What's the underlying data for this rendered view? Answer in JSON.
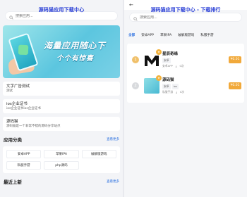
{
  "left": {
    "title": "源码猫应用下载中心",
    "search_placeholder": "搜索应用...",
    "banner": {
      "line1": "海量应用随心下",
      "line2": "个个有惊喜"
    },
    "cards": [
      {
        "title": "文字广告测试",
        "subtitle": "测试"
      },
      {
        "title": "ios企业证书",
        "subtitle": "ios企业证书ios企业证书"
      },
      {
        "title": "源码猫",
        "subtitle": "源码猫是一个非常不错的源码分享站点"
      }
    ],
    "categories": {
      "heading": "应用分类",
      "more": "查看更多",
      "items": [
        "安卓APP",
        "苹果IPA",
        "破解版游戏",
        "私服手游",
        "php源码"
      ]
    },
    "latest": {
      "heading": "最近上新",
      "more": "查看更多"
    }
  },
  "right": {
    "back_icon": "arrow-left-icon",
    "title": "源码猫应用下载中心 - 下载排行",
    "search_placeholder": "搜索应用...",
    "tabs": [
      "全部",
      "安卓APP",
      "苹果IPA",
      "破解版游戏",
      "私服手游"
    ],
    "active_tab": "全部",
    "ranking": [
      {
        "rank": "1",
        "name": "星辰奇缘",
        "tags": [
          "安卓"
        ],
        "category": "安卓APP",
        "downloads": "0次",
        "price": "¥0.01"
      },
      {
        "rank": "2",
        "name": "源码猫",
        "tags": [
          "安卓",
          "ios"
        ],
        "category": "私服手游",
        "downloads": "0次",
        "price": "¥0.01"
      }
    ]
  },
  "colors": {
    "accent": "#2a3fd6",
    "link": "#2a6fe0",
    "price": "#f1a93a",
    "gold": "#f0c06a"
  }
}
